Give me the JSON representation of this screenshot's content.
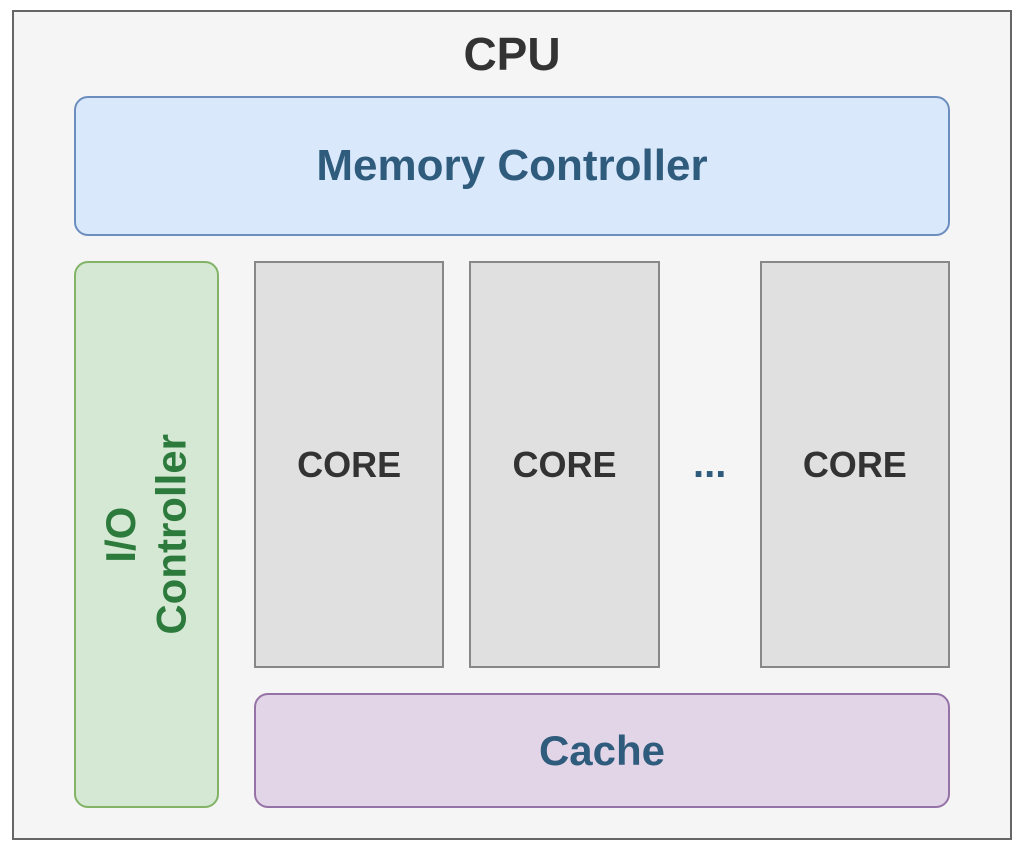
{
  "diagram": {
    "title": "CPU",
    "memory_controller": "Memory Controller",
    "io_controller": "I/O\nController",
    "cores": {
      "core1": "CORE",
      "core2": "CORE",
      "ellipsis": "...",
      "core3": "CORE"
    },
    "cache": "Cache"
  }
}
